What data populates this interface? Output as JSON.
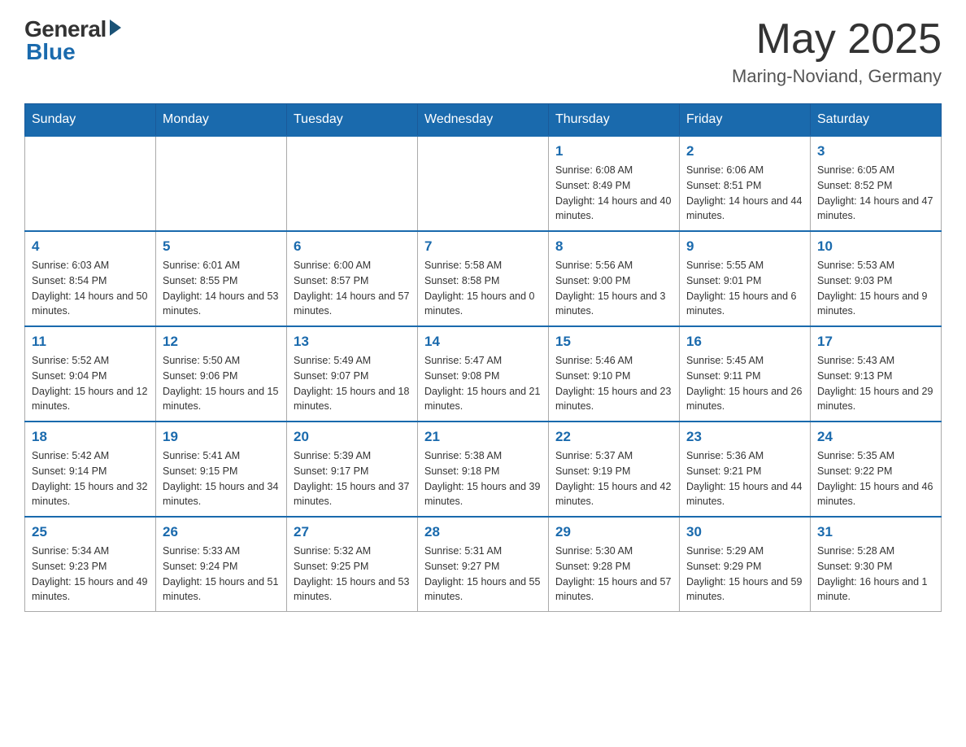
{
  "header": {
    "logo_general": "General",
    "logo_blue": "Blue",
    "month_title": "May 2025",
    "location": "Maring-Noviand, Germany"
  },
  "days_of_week": [
    "Sunday",
    "Monday",
    "Tuesday",
    "Wednesday",
    "Thursday",
    "Friday",
    "Saturday"
  ],
  "weeks": [
    [
      {
        "day": "",
        "info": ""
      },
      {
        "day": "",
        "info": ""
      },
      {
        "day": "",
        "info": ""
      },
      {
        "day": "",
        "info": ""
      },
      {
        "day": "1",
        "info": "Sunrise: 6:08 AM\nSunset: 8:49 PM\nDaylight: 14 hours and 40 minutes."
      },
      {
        "day": "2",
        "info": "Sunrise: 6:06 AM\nSunset: 8:51 PM\nDaylight: 14 hours and 44 minutes."
      },
      {
        "day": "3",
        "info": "Sunrise: 6:05 AM\nSunset: 8:52 PM\nDaylight: 14 hours and 47 minutes."
      }
    ],
    [
      {
        "day": "4",
        "info": "Sunrise: 6:03 AM\nSunset: 8:54 PM\nDaylight: 14 hours and 50 minutes."
      },
      {
        "day": "5",
        "info": "Sunrise: 6:01 AM\nSunset: 8:55 PM\nDaylight: 14 hours and 53 minutes."
      },
      {
        "day": "6",
        "info": "Sunrise: 6:00 AM\nSunset: 8:57 PM\nDaylight: 14 hours and 57 minutes."
      },
      {
        "day": "7",
        "info": "Sunrise: 5:58 AM\nSunset: 8:58 PM\nDaylight: 15 hours and 0 minutes."
      },
      {
        "day": "8",
        "info": "Sunrise: 5:56 AM\nSunset: 9:00 PM\nDaylight: 15 hours and 3 minutes."
      },
      {
        "day": "9",
        "info": "Sunrise: 5:55 AM\nSunset: 9:01 PM\nDaylight: 15 hours and 6 minutes."
      },
      {
        "day": "10",
        "info": "Sunrise: 5:53 AM\nSunset: 9:03 PM\nDaylight: 15 hours and 9 minutes."
      }
    ],
    [
      {
        "day": "11",
        "info": "Sunrise: 5:52 AM\nSunset: 9:04 PM\nDaylight: 15 hours and 12 minutes."
      },
      {
        "day": "12",
        "info": "Sunrise: 5:50 AM\nSunset: 9:06 PM\nDaylight: 15 hours and 15 minutes."
      },
      {
        "day": "13",
        "info": "Sunrise: 5:49 AM\nSunset: 9:07 PM\nDaylight: 15 hours and 18 minutes."
      },
      {
        "day": "14",
        "info": "Sunrise: 5:47 AM\nSunset: 9:08 PM\nDaylight: 15 hours and 21 minutes."
      },
      {
        "day": "15",
        "info": "Sunrise: 5:46 AM\nSunset: 9:10 PM\nDaylight: 15 hours and 23 minutes."
      },
      {
        "day": "16",
        "info": "Sunrise: 5:45 AM\nSunset: 9:11 PM\nDaylight: 15 hours and 26 minutes."
      },
      {
        "day": "17",
        "info": "Sunrise: 5:43 AM\nSunset: 9:13 PM\nDaylight: 15 hours and 29 minutes."
      }
    ],
    [
      {
        "day": "18",
        "info": "Sunrise: 5:42 AM\nSunset: 9:14 PM\nDaylight: 15 hours and 32 minutes."
      },
      {
        "day": "19",
        "info": "Sunrise: 5:41 AM\nSunset: 9:15 PM\nDaylight: 15 hours and 34 minutes."
      },
      {
        "day": "20",
        "info": "Sunrise: 5:39 AM\nSunset: 9:17 PM\nDaylight: 15 hours and 37 minutes."
      },
      {
        "day": "21",
        "info": "Sunrise: 5:38 AM\nSunset: 9:18 PM\nDaylight: 15 hours and 39 minutes."
      },
      {
        "day": "22",
        "info": "Sunrise: 5:37 AM\nSunset: 9:19 PM\nDaylight: 15 hours and 42 minutes."
      },
      {
        "day": "23",
        "info": "Sunrise: 5:36 AM\nSunset: 9:21 PM\nDaylight: 15 hours and 44 minutes."
      },
      {
        "day": "24",
        "info": "Sunrise: 5:35 AM\nSunset: 9:22 PM\nDaylight: 15 hours and 46 minutes."
      }
    ],
    [
      {
        "day": "25",
        "info": "Sunrise: 5:34 AM\nSunset: 9:23 PM\nDaylight: 15 hours and 49 minutes."
      },
      {
        "day": "26",
        "info": "Sunrise: 5:33 AM\nSunset: 9:24 PM\nDaylight: 15 hours and 51 minutes."
      },
      {
        "day": "27",
        "info": "Sunrise: 5:32 AM\nSunset: 9:25 PM\nDaylight: 15 hours and 53 minutes."
      },
      {
        "day": "28",
        "info": "Sunrise: 5:31 AM\nSunset: 9:27 PM\nDaylight: 15 hours and 55 minutes."
      },
      {
        "day": "29",
        "info": "Sunrise: 5:30 AM\nSunset: 9:28 PM\nDaylight: 15 hours and 57 minutes."
      },
      {
        "day": "30",
        "info": "Sunrise: 5:29 AM\nSunset: 9:29 PM\nDaylight: 15 hours and 59 minutes."
      },
      {
        "day": "31",
        "info": "Sunrise: 5:28 AM\nSunset: 9:30 PM\nDaylight: 16 hours and 1 minute."
      }
    ]
  ]
}
